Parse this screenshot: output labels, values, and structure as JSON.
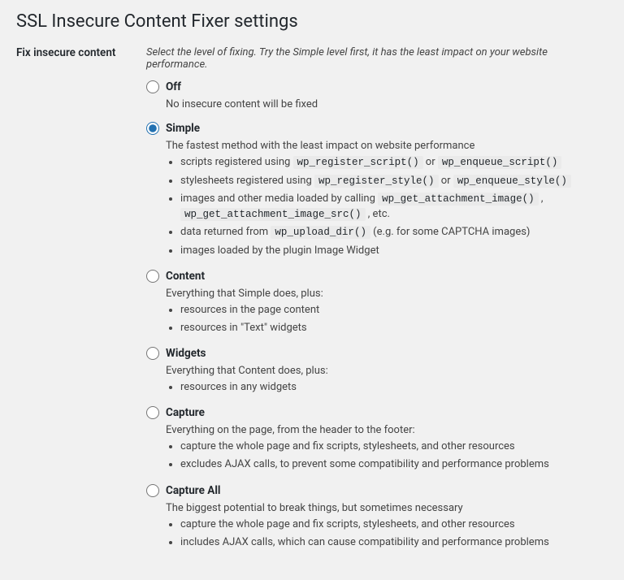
{
  "page": {
    "title": "SSL Insecure Content Fixer settings"
  },
  "section": {
    "label": "Fix insecure content",
    "intro": "Select the level of fixing. Try the Simple level first, it has the least impact on your website performance."
  },
  "options": {
    "selected": "simple",
    "off": {
      "label": "Off",
      "desc": "No insecure content will be fixed"
    },
    "simple": {
      "label": "Simple",
      "desc": "The fastest method with the least impact on website performance",
      "b1_pre": "scripts registered using ",
      "b1_c1": "wp_register_script()",
      "b1_mid": " or ",
      "b1_c2": "wp_enqueue_script()",
      "b2_pre": "stylesheets registered using ",
      "b2_c1": "wp_register_style()",
      "b2_mid": " or ",
      "b2_c2": "wp_enqueue_style()",
      "b3_pre": "images and other media loaded by calling ",
      "b3_c1": "wp_get_attachment_image()",
      "b3_sep": " , ",
      "b3_c2": "wp_get_attachment_image_src()",
      "b3_post": " , etc.",
      "b4_pre": "data returned from ",
      "b4_c1": "wp_upload_dir()",
      "b4_post": " (e.g. for some CAPTCHA images)",
      "b5": "images loaded by the plugin Image Widget"
    },
    "content": {
      "label": "Content",
      "desc": "Everything that Simple does, plus:",
      "b1": "resources in the page content",
      "b2": "resources in \"Text\" widgets"
    },
    "widgets": {
      "label": "Widgets",
      "desc": "Everything that Content does, plus:",
      "b1": "resources in any widgets"
    },
    "capture": {
      "label": "Capture",
      "desc": "Everything on the page, from the header to the footer:",
      "b1": "capture the whole page and fix scripts, stylesheets, and other resources",
      "b2": "excludes AJAX calls, to prevent some compatibility and performance problems"
    },
    "capture_all": {
      "label": "Capture All",
      "desc": "The biggest potential to break things, but sometimes necessary",
      "b1": "capture the whole page and fix scripts, stylesheets, and other resources",
      "b2": "includes AJAX calls, which can cause compatibility and performance problems"
    }
  }
}
